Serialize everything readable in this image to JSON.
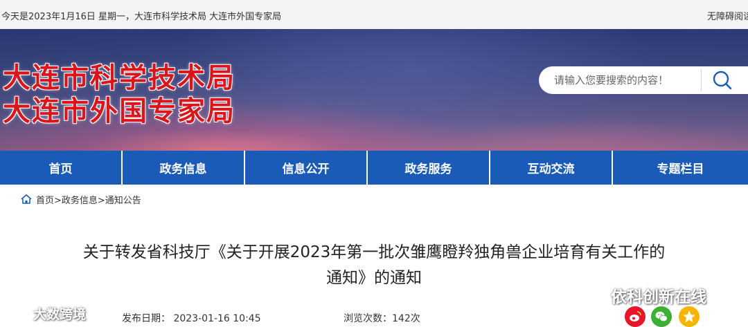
{
  "topbar": {
    "date_text": "今天是2023年1月16日 星期一，大连市科学技术局 大连市外国专家局",
    "accessibility_link": "无障碍阅读"
  },
  "header": {
    "logo_line1": "大连市科学技术局",
    "logo_line2": "大连市外国专家局",
    "search_placeholder": "请输入您要搜索的内容！",
    "search_icon": "search-icon"
  },
  "nav": {
    "items": [
      {
        "label": "首页"
      },
      {
        "label": "政务信息"
      },
      {
        "label": "信息公开"
      },
      {
        "label": "政务服务"
      },
      {
        "label": "互动交流"
      },
      {
        "label": "专题栏目"
      }
    ]
  },
  "breadcrumb": {
    "icon": "home-icon",
    "text": "首页>政务信息>通知公告"
  },
  "article": {
    "title_line1": "关于转发省科技厅《关于开展2023年第一批次雏鹰瞪羚独角兽企业培育有关工作的",
    "title_line2": "通知》的通知",
    "publish_date": "发布日期：  2023-01-16  10:45",
    "view_count": "浏览次数：142次"
  },
  "watermarks": {
    "wm1": "依科创新在线",
    "wm2": "大数跨境"
  },
  "share": {
    "icons": [
      "weibo-icon",
      "wechat-icon",
      "qzone-icon"
    ]
  },
  "colors": {
    "nav_bg": "#1b5bb8",
    "logo_red": "#d8161c",
    "topbar_bg": "#f3f4f6"
  }
}
